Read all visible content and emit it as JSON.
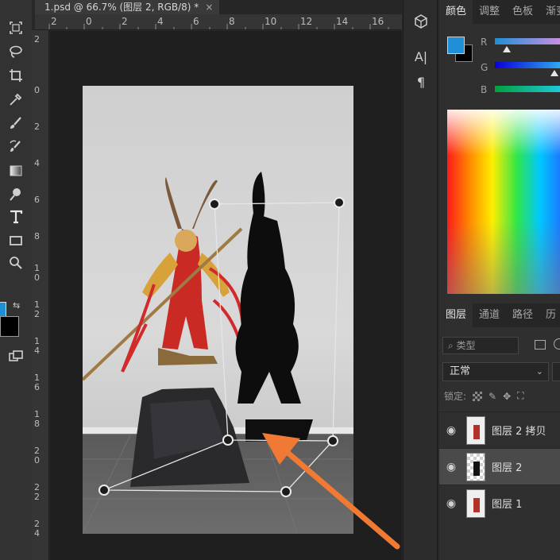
{
  "document_tab": {
    "title": "1.psd @ 66.7% (图层 2, RGB/8) *",
    "close": "×"
  },
  "ruler_top": [
    "2",
    "0",
    "2",
    "4",
    "6",
    "8",
    "10",
    "12",
    "14",
    "16"
  ],
  "ruler_left": [
    "2",
    "0",
    "2",
    "4",
    "6",
    "8",
    "10",
    "12",
    "14",
    "16",
    "18",
    "20",
    "22",
    "24"
  ],
  "tools": [
    "rect-marquee",
    "lasso",
    "crop",
    "eyedropper",
    "brush",
    "history-brush",
    "gradient",
    "dodge",
    "type",
    "rectangle",
    "zoom"
  ],
  "middle_strip": {
    "type_icon": "A|",
    "paragraph_icon": "¶"
  },
  "color_panel": {
    "tabs": [
      "颜色",
      "调整",
      "色板",
      "渐变"
    ],
    "fg_color": "#1f8fd8",
    "bg_color": "#000000",
    "channels": [
      "R",
      "G",
      "B"
    ]
  },
  "layers_panel": {
    "tabs": [
      "图层",
      "通道",
      "路径",
      "历"
    ],
    "search_placeholder": "类型",
    "blend_mode": "正常",
    "lock_label": "锁定:",
    "layers": [
      {
        "name": "图层 2 拷贝",
        "selected": false
      },
      {
        "name": "图层 2",
        "selected": true
      },
      {
        "name": "图层 1",
        "selected": false
      }
    ]
  },
  "annotation": {
    "arrow_color": "#f07a33"
  }
}
